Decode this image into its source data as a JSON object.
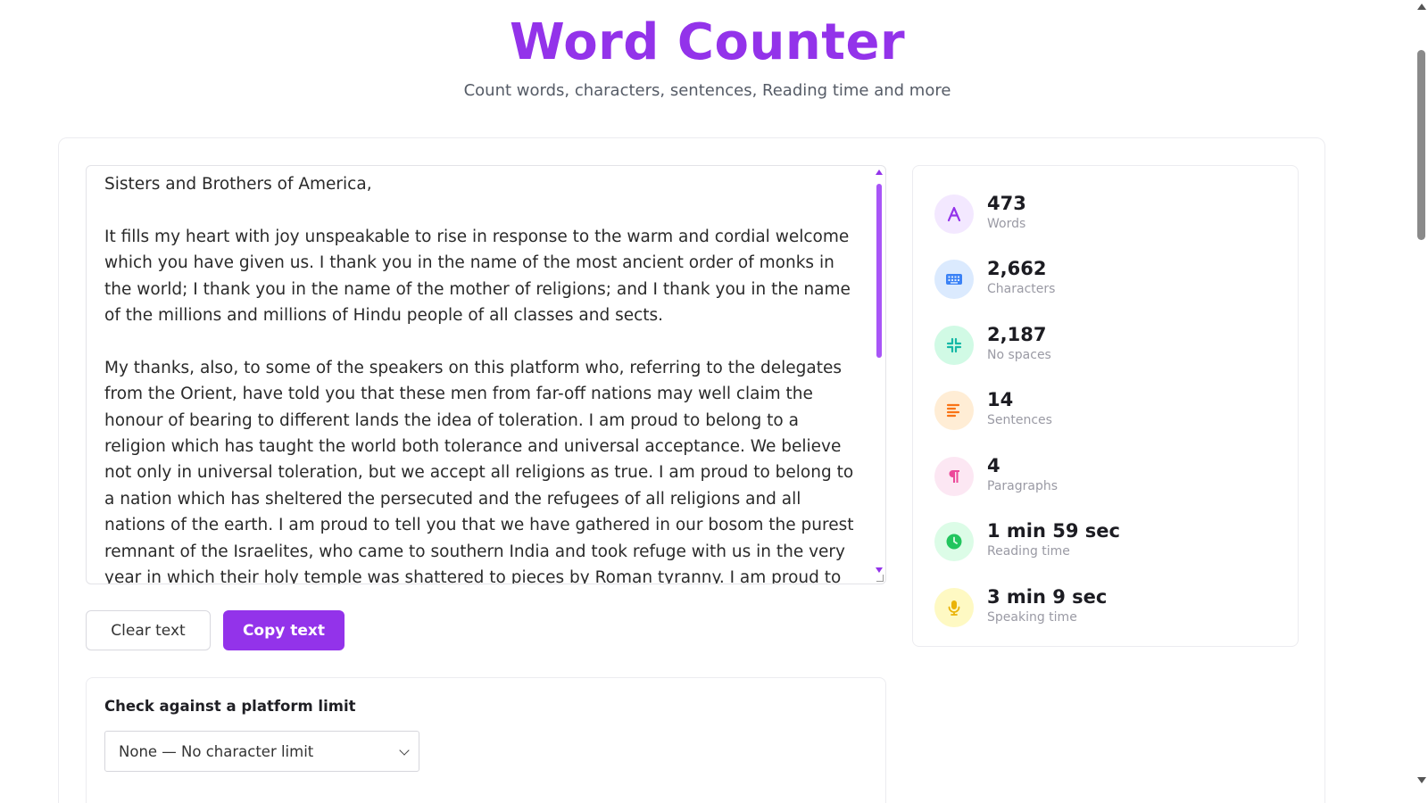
{
  "header": {
    "title": "Word Counter",
    "subtitle": "Count words, characters, sentences, Reading time and more"
  },
  "editor": {
    "text": "Sisters and Brothers of America,\n\nIt fills my heart with joy unspeakable to rise in response to the warm and cordial welcome which you have given us. I thank you in the name of the most ancient order of monks in the world; I thank you in the name of the mother of religions; and I thank you in the name of the millions and millions of Hindu people of all classes and sects.\n\nMy thanks, also, to some of the speakers on this platform who, referring to the delegates from the Orient, have told you that these men from far-off nations may well claim the honour of bearing to different lands the idea of toleration. I am proud to belong to a religion which has taught the world both tolerance and universal acceptance. We believe not only in universal toleration, but we accept all religions as true. I am proud to belong to a nation which has sheltered the persecuted and the refugees of all religions and all nations of the earth. I am proud to tell you that we have gathered in our bosom the purest remnant of the Israelites, who came to southern India and took refuge with us in the very year in which their holy temple was shattered to pieces by Roman tyranny. I am proud to belong to the religion which has sheltered"
  },
  "buttons": {
    "clear": "Clear text",
    "copy": "Copy text"
  },
  "platform_limit": {
    "label": "Check against a platform limit",
    "selected": "None — No character limit"
  },
  "stats": [
    {
      "value": "473",
      "label": "Words",
      "icon": "letter-a-icon",
      "bg": "#f3e8ff",
      "fg": "#9333ea"
    },
    {
      "value": "2,662",
      "label": "Characters",
      "icon": "keyboard-icon",
      "bg": "#dbeafe",
      "fg": "#3b82f6"
    },
    {
      "value": "2,187",
      "label": "No spaces",
      "icon": "compress-icon",
      "bg": "#d1fae5",
      "fg": "#14b8a6"
    },
    {
      "value": "14",
      "label": "Sentences",
      "icon": "align-left-icon",
      "bg": "#ffedd5",
      "fg": "#f97316"
    },
    {
      "value": "4",
      "label": "Paragraphs",
      "icon": "pilcrow-icon",
      "bg": "#fce7f3",
      "fg": "#ec4899"
    },
    {
      "value": "1 min 59 sec",
      "label": "Reading time",
      "icon": "clock-icon",
      "bg": "#dcfce7",
      "fg": "#22c55e"
    },
    {
      "value": "3 min 9 sec",
      "label": "Speaking time",
      "icon": "microphone-icon",
      "bg": "#fef9c3",
      "fg": "#eab308"
    }
  ]
}
